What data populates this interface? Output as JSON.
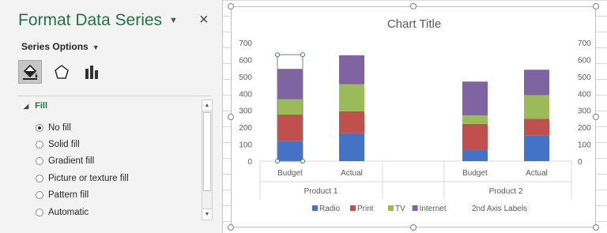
{
  "pane": {
    "title": "Format Data Series",
    "dropdown_icon": "dropdown-arrow-icon",
    "close_label": "×",
    "series_options_label": "Series Options",
    "tabs": [
      "fill-line-icon",
      "effects-icon",
      "series-options-icon"
    ],
    "section": "Fill",
    "fill_options": [
      {
        "label": "No fill",
        "selected": true
      },
      {
        "label": "Solid fill",
        "selected": false
      },
      {
        "label": "Gradient fill",
        "selected": false
      },
      {
        "label": "Picture or texture fill",
        "selected": false
      },
      {
        "label": "Pattern fill",
        "selected": false
      },
      {
        "label": "Automatic",
        "selected": false
      }
    ]
  },
  "chart_data": {
    "type": "bar",
    "title": "Chart Title",
    "stacked": true,
    "categories": [
      "Budget",
      "Actual",
      "Budget",
      "Actual"
    ],
    "groups": [
      "Product 1",
      "Product 2"
    ],
    "ylim": [
      0,
      700
    ],
    "yticks": [
      "0",
      "100",
      "200",
      "300",
      "400",
      "500",
      "600",
      "700"
    ],
    "secondary_yticks": [
      "0",
      "100",
      "200",
      "300",
      "400",
      "500",
      "600",
      "700"
    ],
    "series": [
      {
        "name": "Radio",
        "color": "#4472c4",
        "values": [
          120,
          165,
          65,
          150
        ]
      },
      {
        "name": "Print",
        "color": "#c0504d",
        "values": [
          155,
          130,
          155,
          100
        ]
      },
      {
        "name": "TV",
        "color": "#9bbb59",
        "values": [
          90,
          160,
          50,
          140
        ]
      },
      {
        "name": "Internet",
        "color": "#8064a2",
        "values": [
          180,
          170,
          200,
          150
        ]
      }
    ],
    "extra_legend": "2nd Axis Labels",
    "legend_position": "bottom",
    "grid": false
  }
}
